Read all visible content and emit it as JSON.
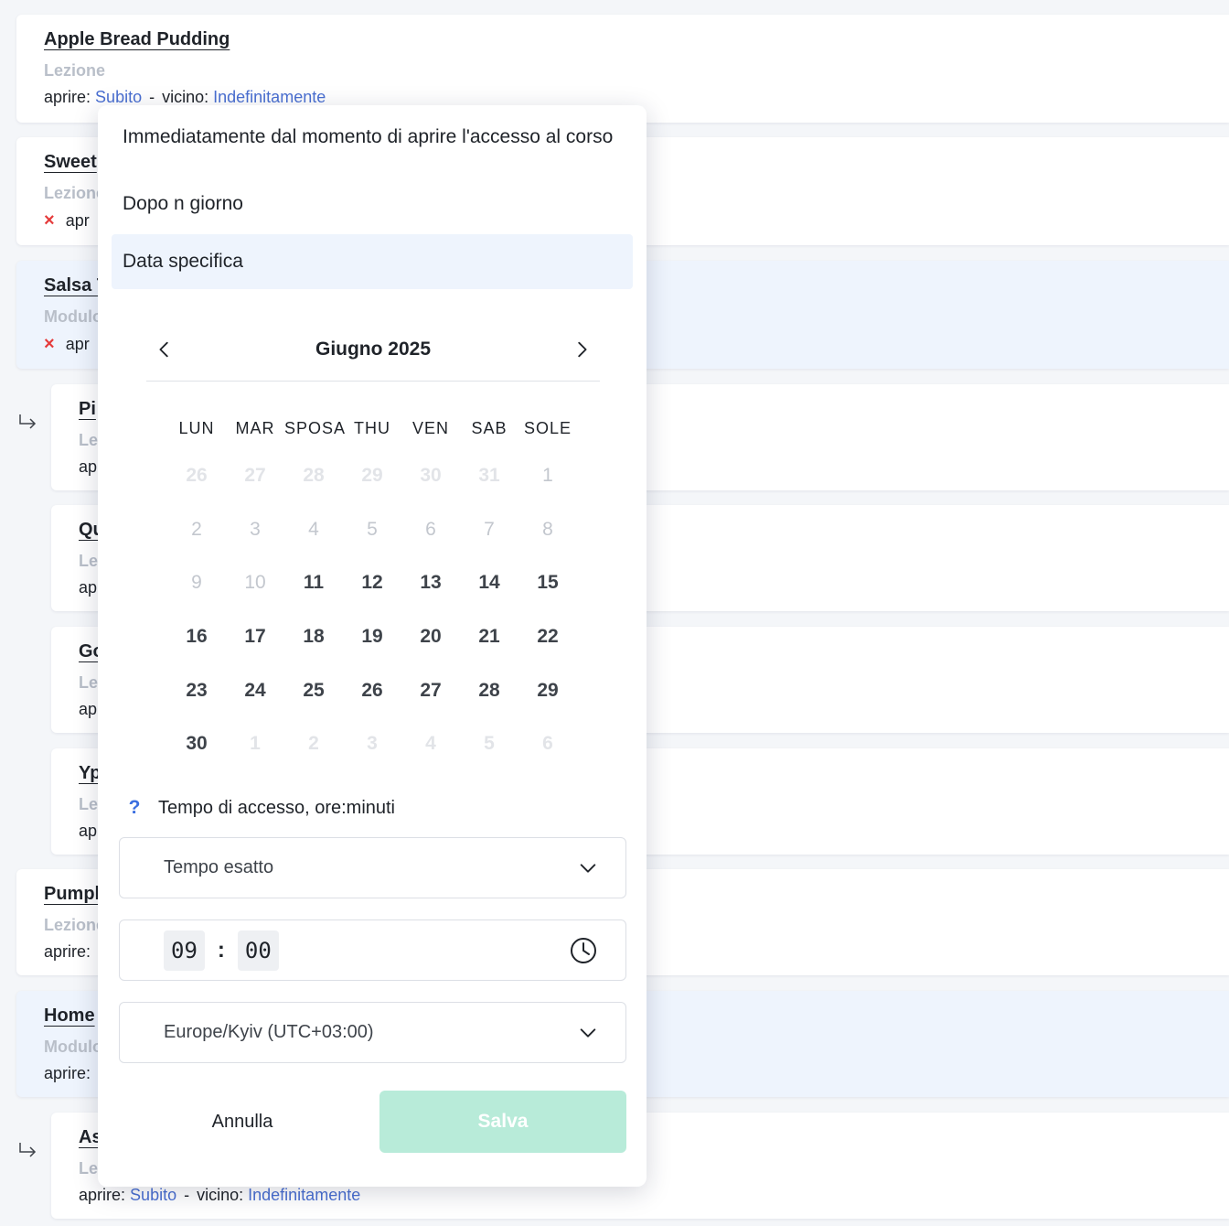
{
  "items": [
    {
      "title": "Apple Bread Pudding",
      "type": "Lezione",
      "open_label": "aprire:",
      "open_value": "Subito",
      "close_label": "vicino:",
      "close_value": "Indefinitamente"
    },
    {
      "title": "Sweet",
      "type": "Lezione",
      "open_label": "apr"
    },
    {
      "title": "Salsa T",
      "type": "Modulo",
      "open_label": "apr"
    },
    {
      "title": "Pi",
      "type": "Le",
      "open_label": "ap"
    },
    {
      "title": "Qu",
      "type": "Le",
      "open_label": "ap"
    },
    {
      "title": "Go",
      "type": "Le",
      "open_label": "ap"
    },
    {
      "title": "Yp",
      "type": "Le",
      "open_label": "ap"
    },
    {
      "title": "Pumpk",
      "type": "Lezione",
      "open_label": "aprire:"
    },
    {
      "title": "Home",
      "type": "Modulo",
      "open_label": "aprire:"
    },
    {
      "title": "As",
      "type": "Le",
      "open_label": "aprire:",
      "open_value": "Subito",
      "close_label": "vicino:",
      "close_value": "Indefinitamente"
    }
  ],
  "popup": {
    "options": [
      "Immediatamente dal momento di aprire l'accesso al corso",
      "Dopo n giorno",
      "Data specifica"
    ],
    "calendar": {
      "month_title": "Giugno 2025",
      "weekdays": [
        "LUN",
        "MAR",
        "SPOSA",
        "THU",
        "VEN",
        "SAB",
        "SOLE"
      ],
      "weeks": [
        [
          "26",
          "27",
          "28",
          "29",
          "30",
          "31",
          "1"
        ],
        [
          "2",
          "3",
          "4",
          "5",
          "6",
          "7",
          "8"
        ],
        [
          "9",
          "10",
          "11",
          "12",
          "13",
          "14",
          "15"
        ],
        [
          "16",
          "17",
          "18",
          "19",
          "20",
          "21",
          "22"
        ],
        [
          "23",
          "24",
          "25",
          "26",
          "27",
          "28",
          "29"
        ],
        [
          "30",
          "1",
          "2",
          "3",
          "4",
          "5",
          "6"
        ]
      ]
    },
    "access_time_label": "Tempo di accesso, ore:minuti",
    "help_glyph": "?",
    "time_mode": "Tempo esatto",
    "time": {
      "hours": "09",
      "separator": ":",
      "minutes": "00"
    },
    "timezone": "Europe/Kyiv (UTC+03:00)",
    "cancel_label": "Annulla",
    "save_label": "Salva"
  },
  "colors": {
    "accent_link": "#4a6fd1",
    "save_disabled": "#b8ebd9",
    "selected_bg": "#eef4fd",
    "error_x": "#e53b3b"
  },
  "icons": {
    "nav_prev": "chevron-left-icon",
    "nav_next": "chevron-right-icon",
    "dropdown": "chevron-down-icon",
    "clock": "clock-icon",
    "child": "child-arrow-icon",
    "close": "x-icon"
  }
}
